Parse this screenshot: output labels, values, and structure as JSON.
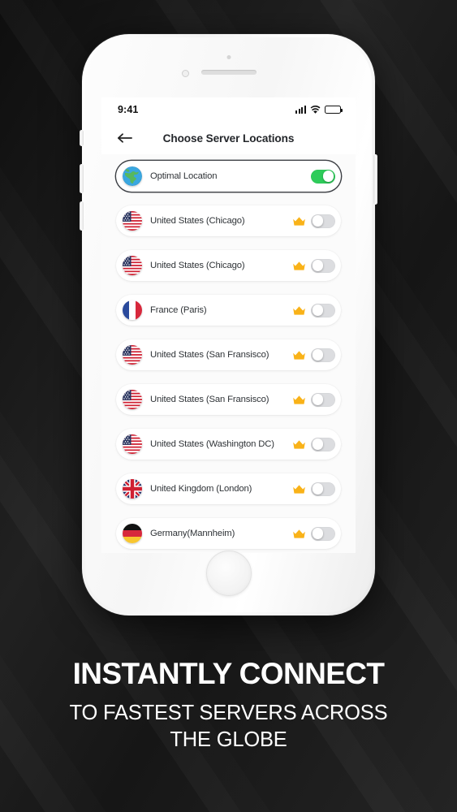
{
  "status_bar": {
    "time": "9:41",
    "signal_icon": "signal-bars-icon",
    "wifi_icon": "wifi-icon",
    "battery_icon": "battery-icon"
  },
  "nav": {
    "back_icon": "back-arrow-icon",
    "title": "Choose Server Locations"
  },
  "colors": {
    "toggle_on": "#2ecc5a",
    "toggle_off": "#dcdde0",
    "crown": "#f9b218",
    "background": "#141414",
    "text": "#2f3337"
  },
  "servers": [
    {
      "label": "Optimal Location",
      "flag": "globe",
      "premium": false,
      "enabled": true,
      "selected": true
    },
    {
      "label": "United States (Chicago)",
      "flag": "us",
      "premium": true,
      "enabled": false,
      "selected": false
    },
    {
      "label": "United States (Chicago)",
      "flag": "us",
      "premium": true,
      "enabled": false,
      "selected": false
    },
    {
      "label": "France (Paris)",
      "flag": "fr",
      "premium": true,
      "enabled": false,
      "selected": false
    },
    {
      "label": "United States (San Fransisco)",
      "flag": "us",
      "premium": true,
      "enabled": false,
      "selected": false
    },
    {
      "label": "United States (San Fransisco)",
      "flag": "us",
      "premium": true,
      "enabled": false,
      "selected": false
    },
    {
      "label": "United States (Washington DC)",
      "flag": "us",
      "premium": true,
      "enabled": false,
      "selected": false
    },
    {
      "label": "United Kingdom (London)",
      "flag": "gb",
      "premium": true,
      "enabled": false,
      "selected": false
    },
    {
      "label": "Germany(Mannheim)",
      "flag": "de",
      "premium": true,
      "enabled": false,
      "selected": false
    }
  ],
  "marketing": {
    "headline": "INSTANTLY CONNECT",
    "subheadline_line1": "TO FASTEST SERVERS ACROSS",
    "subheadline_line2": "THE GLOBE"
  },
  "device": {
    "speaker": "earpiece-speaker",
    "camera": "front-camera-icon",
    "home_button": "home-button"
  }
}
